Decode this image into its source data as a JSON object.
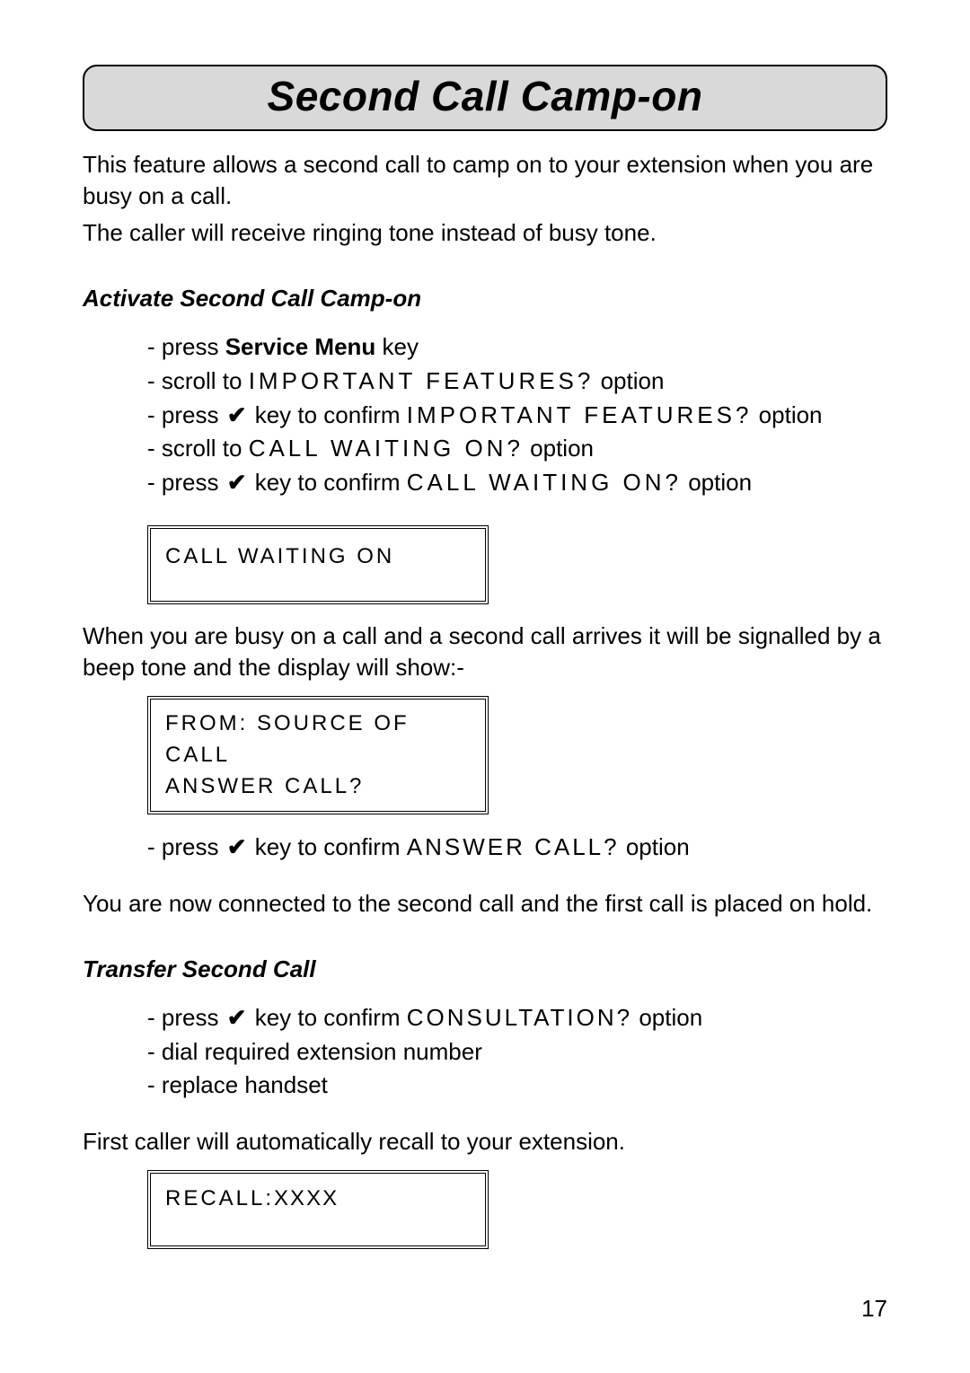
{
  "title": "Second Call Camp-on",
  "intro1": "This feature allows a second call to camp on to  your extension when you are busy on a call.",
  "intro2": "The caller will receive ringing tone instead of busy tone.",
  "section1": {
    "heading": "Activate Second Call Camp-on",
    "steps": {
      "s1_a": "- press ",
      "s1_b": "Service Menu",
      "s1_c": " key",
      "s2_a": "- scroll to ",
      "s2_lcd": "IMPORTANT FEATURES?",
      "s2_b": " option",
      "s3_a": "- press  ",
      "s3_b": "  key to confirm ",
      "s3_lcd": "IMPORTANT FEATURES?",
      "s3_c": " option",
      "s4_a": "- scroll to ",
      "s4_lcd": "CALL WAITING ON?",
      "s4_b": " option",
      "s5_a": "- press  ",
      "s5_b": "  key to confirm  ",
      "s5_lcd": "CALL WAITING ON?",
      "s5_c": " option"
    }
  },
  "display1": {
    "l1": "CALL WAITING ON"
  },
  "mid1": "When you are busy on a call and a second call arrives it will be signalled by a beep tone and the display will show:-",
  "display2": {
    "l1": "FROM: SOURCE OF CALL",
    "l2": "ANSWER CALL?"
  },
  "afterDisplay2": {
    "a": "- press  ",
    "b": "  key to confirm ",
    "lcd": "ANSWER CALL?",
    "c": " option"
  },
  "mid2": "You are now connected to the second call and the first call is placed on hold.",
  "section2": {
    "heading": "Transfer Second Call",
    "steps": {
      "s1_a": "- press  ",
      "s1_b": "  key to confirm  ",
      "s1_lcd": "CONSULTATION?",
      "s1_c": " option",
      "s2": "- dial required extension number",
      "s3": "- replace handset"
    }
  },
  "mid3": "First caller will automatically recall to your extension.",
  "display3": {
    "l1_prefix": "RECALL:",
    "l1_suffix": "XXXX"
  },
  "checkGlyph": "✔",
  "pageNumber": "17"
}
